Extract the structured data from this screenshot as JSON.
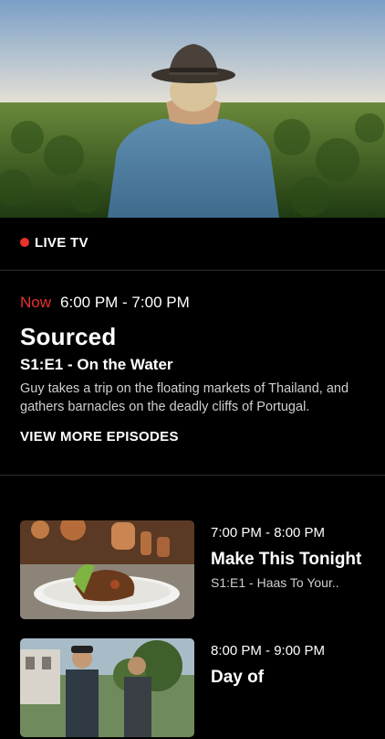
{
  "live": {
    "label": "LIVE TV",
    "dot_color": "#e8322e"
  },
  "current": {
    "now_label": "Now",
    "time": "6:00 PM - 7:00 PM",
    "title": "Sourced",
    "episode": "S1:E1 - On the Water",
    "description": "Guy takes a trip on the floating markets of Thailand, and gathers barnacles on the deadly cliffs of Portugal.",
    "view_more": "VIEW MORE EPISODES"
  },
  "schedule": [
    {
      "time": "7:00 PM - 8:00 PM",
      "title": "Make This Tonight",
      "episode": "S1:E1 - Haas To Your.."
    },
    {
      "time": "8:00 PM - 9:00 PM",
      "title": "Day of",
      "episode": ""
    }
  ],
  "colors": {
    "accent": "#e8322e",
    "background": "#000000"
  }
}
